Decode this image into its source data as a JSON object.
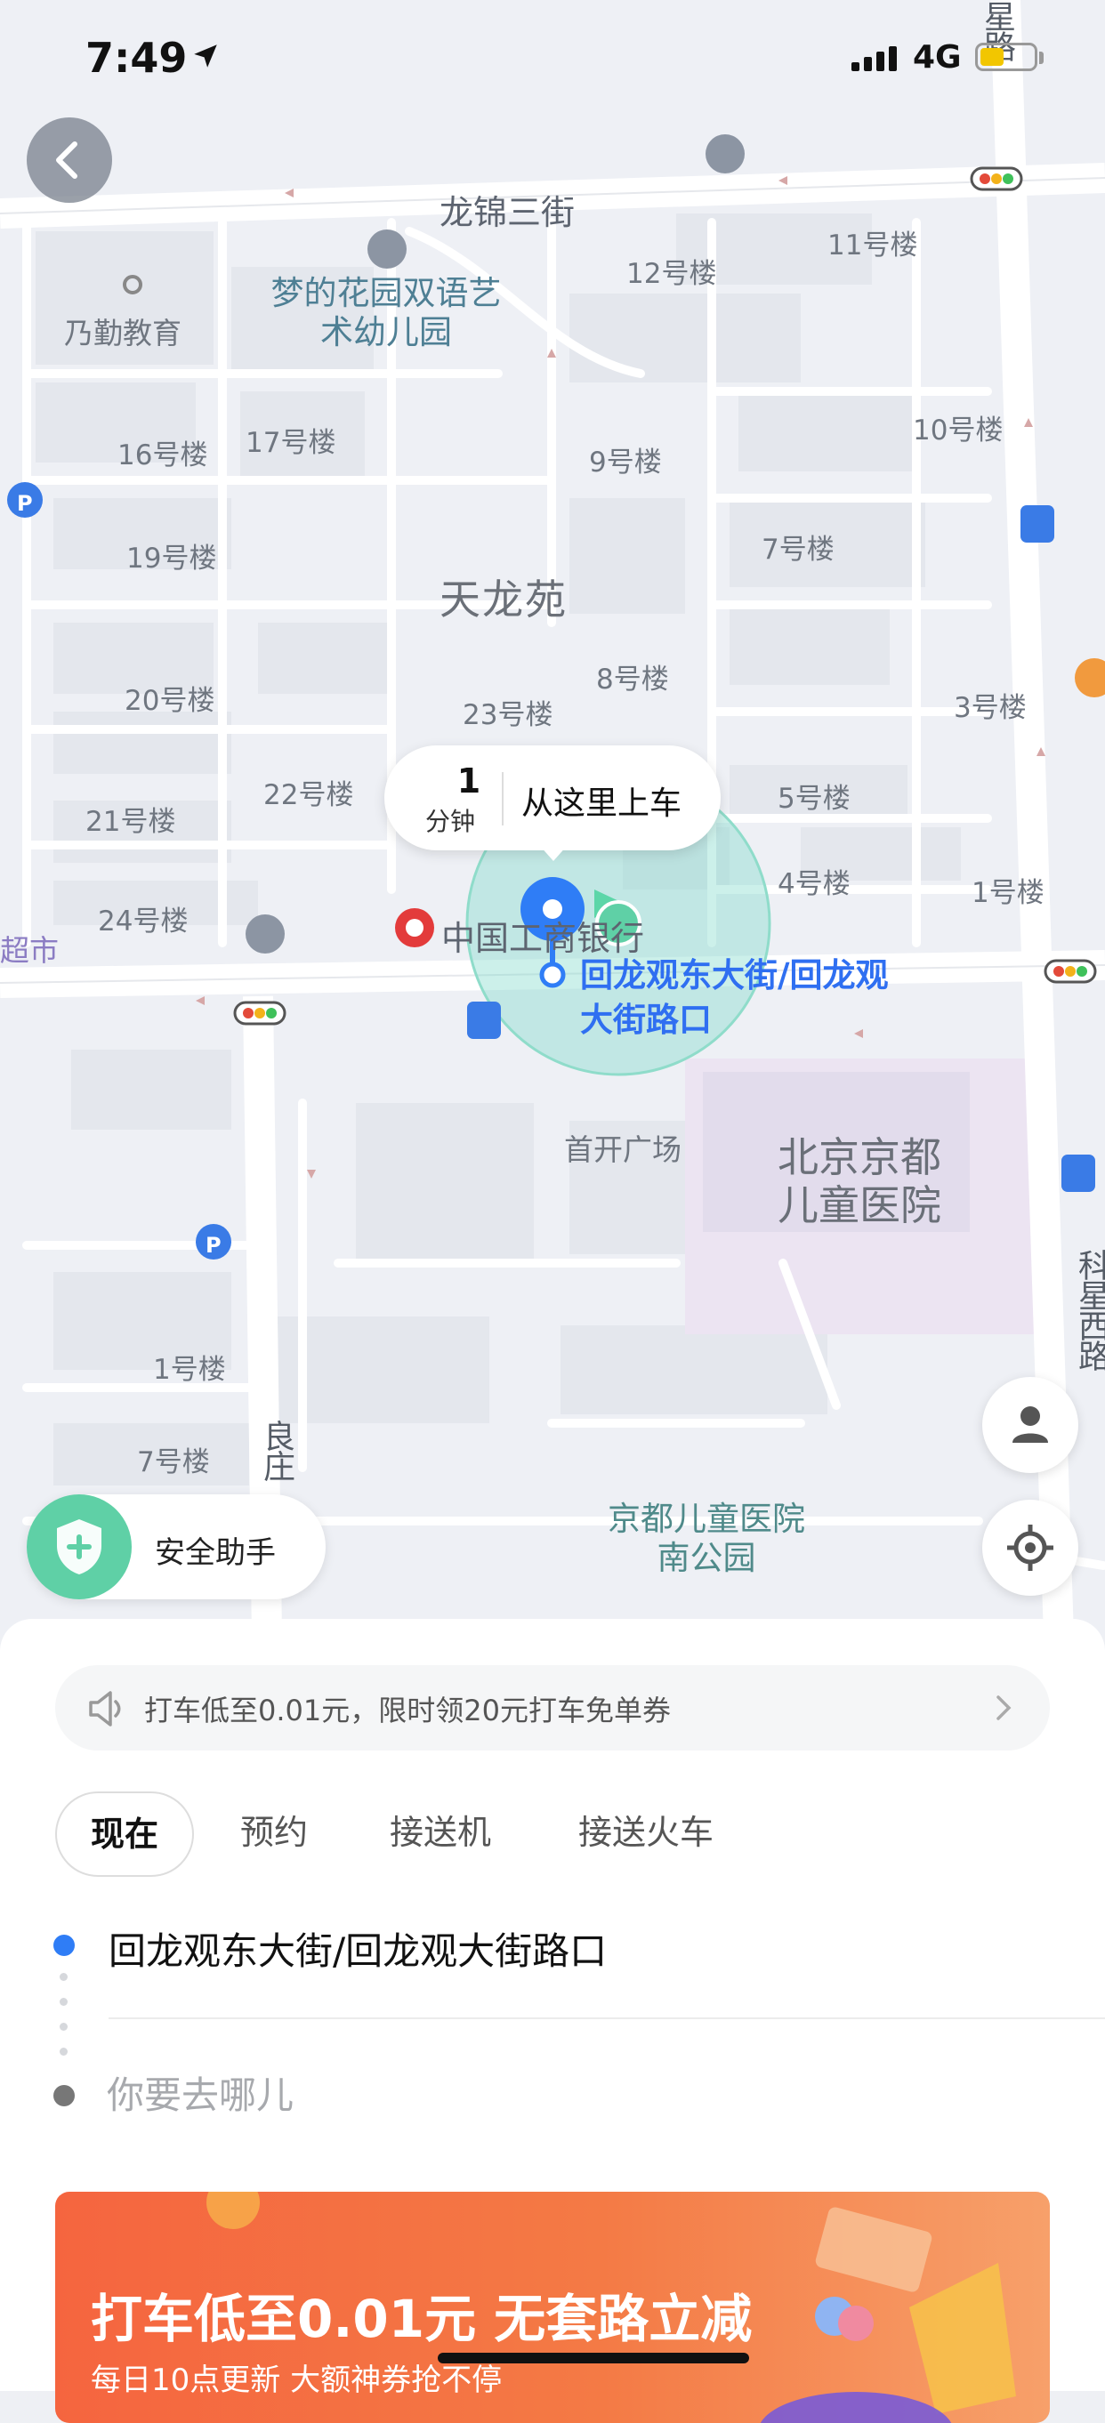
{
  "status_bar": {
    "time": "7:49",
    "network": "4G",
    "icons": [
      "location-arrow-icon",
      "signal-bars-icon",
      "battery-icon"
    ]
  },
  "map": {
    "area_title": "天龙苑",
    "pickup": {
      "minutes": "1",
      "unit": "分钟",
      "label": "从这里上车"
    },
    "location_name": "回龙观东大街/回龙观大街路口",
    "labels": {
      "road_top": "龙锦三街",
      "kindergarten": "梦的花园双语艺术幼儿园",
      "edu": "乃勤教育",
      "b11": "11号楼",
      "b12": "12号楼",
      "b10": "10号楼",
      "b16": "16号楼",
      "b17": "17号楼",
      "b9": "9号楼",
      "b19": "19号楼",
      "b7": "7号楼",
      "b8": "8号楼",
      "b20": "20号楼",
      "b23": "23号楼",
      "b3": "3号楼",
      "b21": "21号楼",
      "b22": "22号楼",
      "b5": "5号楼",
      "b24": "24号楼",
      "b4": "4号楼",
      "b1": "1号楼",
      "supermarket": "超市",
      "bank": "中国工商银行",
      "plaza": "首开广场",
      "hospital": "北京京都儿童医院",
      "b1b": "1号楼",
      "b7b": "7号楼",
      "park": "京都儿童医院南公园",
      "road_right_top": "星路",
      "road_right_bottom": "科星西路",
      "road_left_bottom": "良庄"
    }
  },
  "buttons": {
    "safety": "安全助手"
  },
  "promo_bar": {
    "text": "打车低至0.01元，限时领20元打车免单券"
  },
  "tabs": [
    {
      "label": "现在",
      "active": true
    },
    {
      "label": "预约",
      "active": false
    },
    {
      "label": "接送机",
      "active": false
    },
    {
      "label": "接送火车",
      "active": false
    }
  ],
  "trip": {
    "from": "回龙观东大街/回龙观大街路口",
    "to_placeholder": "你要去哪儿"
  },
  "banner": {
    "title": "打车低至0.01元  无套路立减",
    "subtitle": "每日10点更新   大额神券抢不停"
  },
  "colors": {
    "accent_blue": "#2f7df6",
    "accent_green": "#5fd0a6",
    "banner_orange": "#f5653f"
  }
}
